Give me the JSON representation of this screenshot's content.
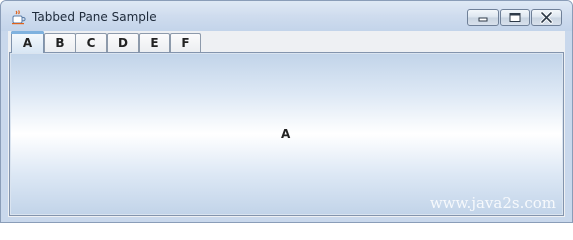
{
  "window": {
    "title": "Tabbed Pane Sample",
    "controls": {
      "minimize_icon": "minimize-icon",
      "maximize_icon": "maximize-icon",
      "close_icon": "close-icon"
    }
  },
  "tabs": [
    {
      "label": "A",
      "selected": true
    },
    {
      "label": "B",
      "selected": false
    },
    {
      "label": "C",
      "selected": false
    },
    {
      "label": "D",
      "selected": false
    },
    {
      "label": "E",
      "selected": false
    },
    {
      "label": "F",
      "selected": false
    }
  ],
  "panel": {
    "content_label": "A"
  },
  "watermark": "www.java2s.com",
  "colors": {
    "accent": "#7fb2df",
    "frame": "#c9d8ec",
    "tab_border": "#8d9aab"
  }
}
